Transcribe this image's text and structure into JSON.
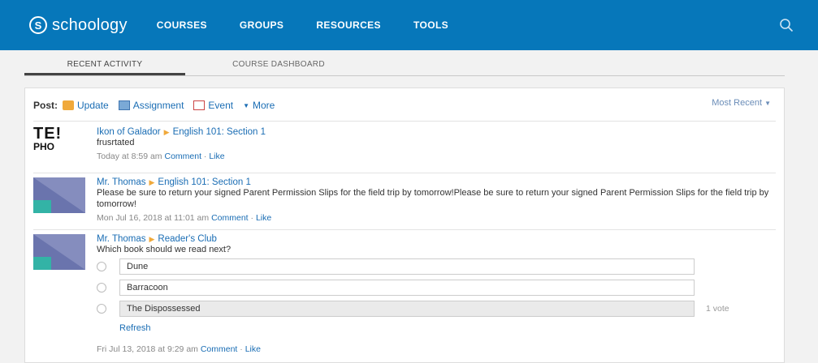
{
  "header": {
    "logo_text": "schoology",
    "logo_mark": "S",
    "nav": [
      "COURSES",
      "GROUPS",
      "RESOURCES",
      "TOOLS"
    ],
    "search_icon": "search-icon"
  },
  "tabs": [
    "RECENT ACTIVITY",
    "COURSE DASHBOARD"
  ],
  "post_bar": {
    "label": "Post:",
    "options": [
      "Update",
      "Assignment",
      "Event",
      "More"
    ],
    "sort": "Most Recent"
  },
  "feed": [
    {
      "author": "Ikon of Galador",
      "course": "English 101: Section 1",
      "text": "frusrtated",
      "time": "Today at 8:59 am",
      "comment": "Comment",
      "like": "Like",
      "avatar_l1": "TE!",
      "avatar_l2": "PHO"
    },
    {
      "author": "Mr. Thomas",
      "course": "English 101: Section 1",
      "text": "Please be sure to return your signed Parent Permission Slips for the field trip by tomorrow!Please be sure to return your signed Parent Permission Slips for the field trip by tomorrow!",
      "time": "Mon Jul 16, 2018 at 11:01 am",
      "comment": "Comment",
      "like": "Like"
    },
    {
      "author": "Mr. Thomas",
      "course": "Reader's Club",
      "text": "Which book should we read next?",
      "poll": [
        "Dune",
        "Barracoon",
        "The Dispossessed"
      ],
      "votes": "1 vote",
      "refresh": "Refresh",
      "time": "Fri Jul 13, 2018 at 9:29 am",
      "comment": "Comment",
      "like": "Like"
    }
  ],
  "colors": {
    "brand": "#0677ba",
    "link": "#1a6db4",
    "accent": "#f0a93b"
  }
}
